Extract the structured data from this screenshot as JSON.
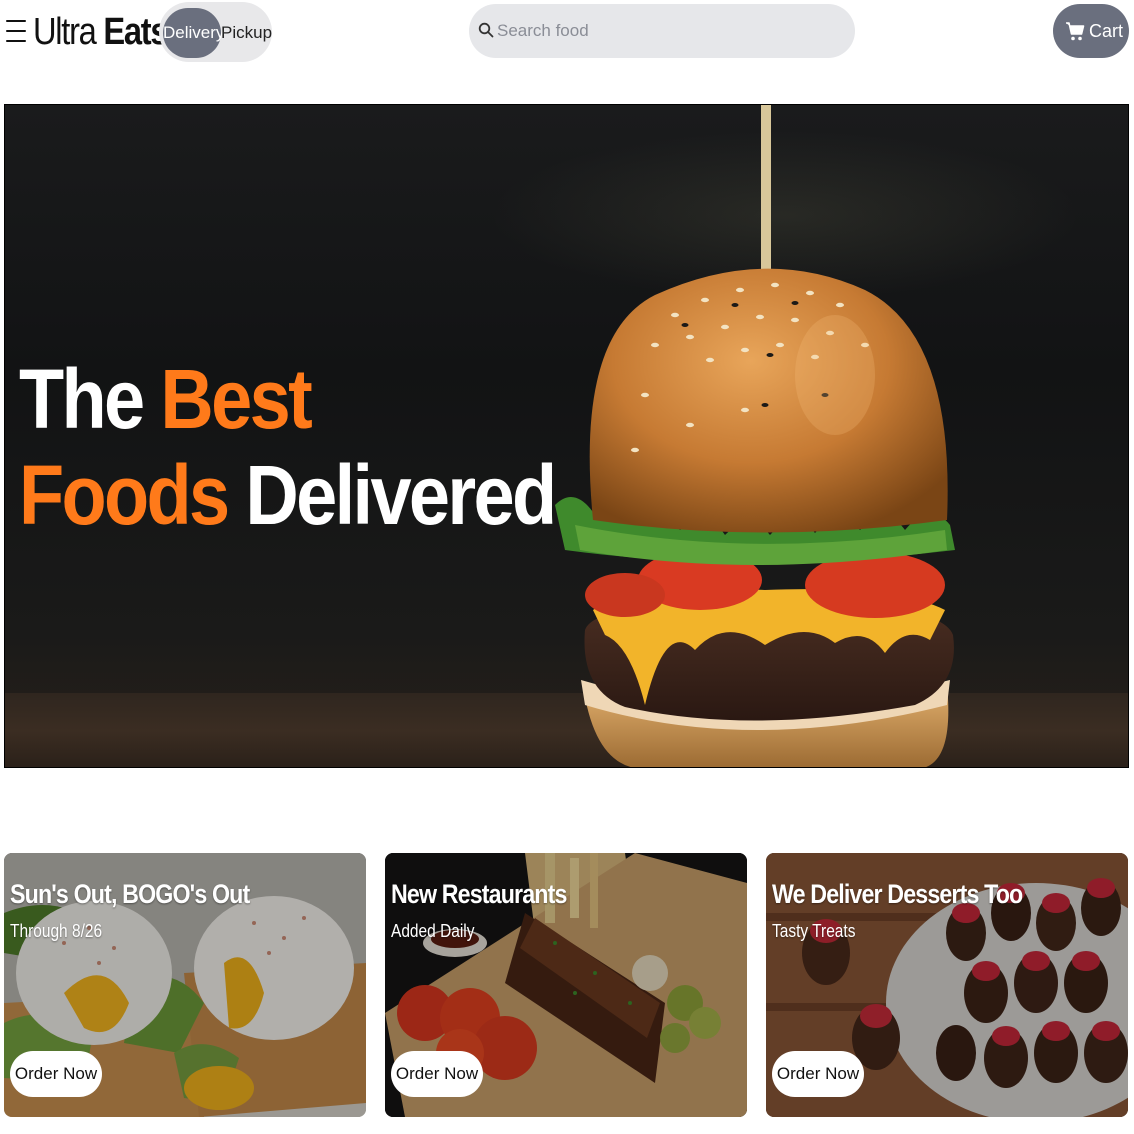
{
  "header": {
    "brand_thin": "Ultra",
    "brand_bold": "Eats",
    "modes": [
      {
        "label": "Delivery",
        "active": true
      },
      {
        "label": "Pickup",
        "active": false
      }
    ],
    "search": {
      "placeholder": "Search food",
      "value": ""
    },
    "cart_label": "Cart"
  },
  "hero": {
    "line1_white": "The",
    "line1_orange": "Best",
    "line2_orange": "Foods",
    "line2_white": "Delivered"
  },
  "promos": [
    {
      "title": "Sun's Out, BOGO's Out",
      "subtitle": "Through 8/26",
      "button": "Order Now"
    },
    {
      "title": "New Restaurants",
      "subtitle": "Added Daily",
      "button": "Order Now"
    },
    {
      "title": "We Deliver Desserts Too",
      "subtitle": "Tasty Treats",
      "button": "Order Now"
    }
  ],
  "colors": {
    "accent_orange": "#ff7a1a",
    "button_gray": "#6a6f7e",
    "field_gray": "#e6e7ea"
  },
  "icons": [
    "menu-icon",
    "search-icon",
    "cart-icon"
  ]
}
